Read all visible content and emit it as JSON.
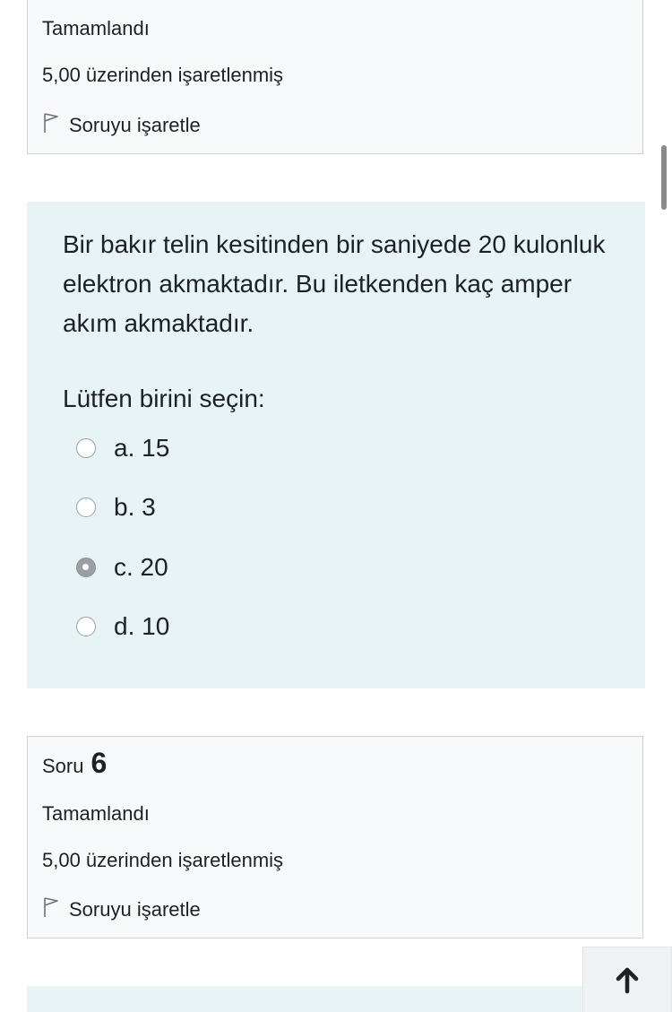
{
  "top_info": {
    "status": "Tamamlandı",
    "grade": "5,00 üzerinden işaretlenmiş",
    "flag_label": "Soruyu işaretle"
  },
  "question": {
    "text": "Bir bakır telin  kesitinden bir saniyede 20 kulonluk elektron akmaktadır. Bu iletkenden kaç amper akım akmaktadır.",
    "prompt": "Lütfen birini seçin:",
    "options": [
      {
        "label": "a. 15",
        "selected": false
      },
      {
        "label": "b. 3",
        "selected": false
      },
      {
        "label": "c. 20",
        "selected": true
      },
      {
        "label": "d. 10",
        "selected": false
      }
    ]
  },
  "next_info": {
    "soru_label": "Soru",
    "soru_number": "6",
    "status": "Tamamlandı",
    "grade": "5,00 üzerinden işaretlenmiş",
    "flag_label": "Soruyu işaretle"
  },
  "back_to_top": {
    "icon": "arrow-up-icon"
  },
  "colors": {
    "question_bg": "#e7f3f5",
    "info_bg": "#f8f9fa",
    "text": "#1d2125"
  }
}
